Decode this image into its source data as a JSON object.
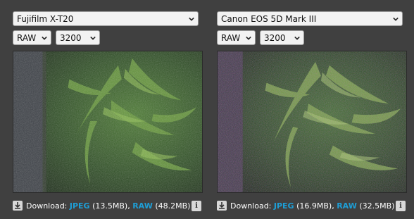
{
  "panels": [
    {
      "camera": "Fujifilm X-T20",
      "format": "RAW",
      "iso": "3200",
      "download": {
        "label": "Download:",
        "jpeg_label": "JPEG",
        "jpeg_size": "(13.5MB),",
        "raw_label": "RAW",
        "raw_size": "(48.2MB)"
      },
      "info_icon": "i"
    },
    {
      "camera": "Canon EOS 5D Mark III",
      "format": "RAW",
      "iso": "3200",
      "download": {
        "label": "Download:",
        "jpeg_label": "JPEG",
        "jpeg_size": "(16.9MB),",
        "raw_label": "RAW",
        "raw_size": "(32.5MB)"
      },
      "info_icon": "i"
    }
  ],
  "icons": {
    "dropdown": "chevron-down-icon",
    "download": "download-icon",
    "info": "info-icon"
  },
  "colors": {
    "page_background": "#404040",
    "link": "#1e9ed6",
    "control_background": "#f2f2f2"
  }
}
